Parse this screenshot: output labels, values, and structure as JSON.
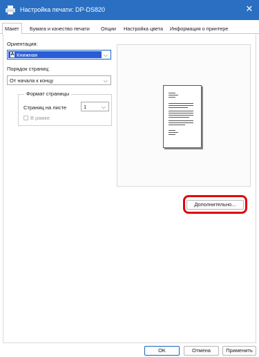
{
  "window": {
    "title": "Настройка печати: DP-DS820",
    "close_glyph": "✕",
    "printer_icon": "printer-icon"
  },
  "tabs": [
    {
      "label": "Макет",
      "active": true
    },
    {
      "label": "Бумага и качество печати",
      "active": false
    },
    {
      "label": "Опции",
      "active": false
    },
    {
      "label": "Настройка цвета",
      "active": false
    },
    {
      "label": "Информация о принтере",
      "active": false
    }
  ],
  "layout": {
    "orientation_label": "Ориентация:",
    "orientation_value": "Книжная",
    "orientation_icon_glyph": "A",
    "page_order_label": "Порядок страниц:",
    "page_order_value": "От начала к концу",
    "pages_format": {
      "title": "Формат страницы",
      "pages_per_sheet_label": "Страниц на листе",
      "pages_per_sheet_value": "1",
      "border_label": "В рамке",
      "border_checked": false
    },
    "dropdown_glyph": "⌵"
  },
  "advanced_button": "Дополнительно...",
  "footer": {
    "ok": "OK",
    "cancel": "Отмена",
    "apply": "Применить"
  },
  "colors": {
    "titlebar": "#2a6fc2",
    "selection": "#2a5cd6",
    "highlight": "#e0000b"
  }
}
